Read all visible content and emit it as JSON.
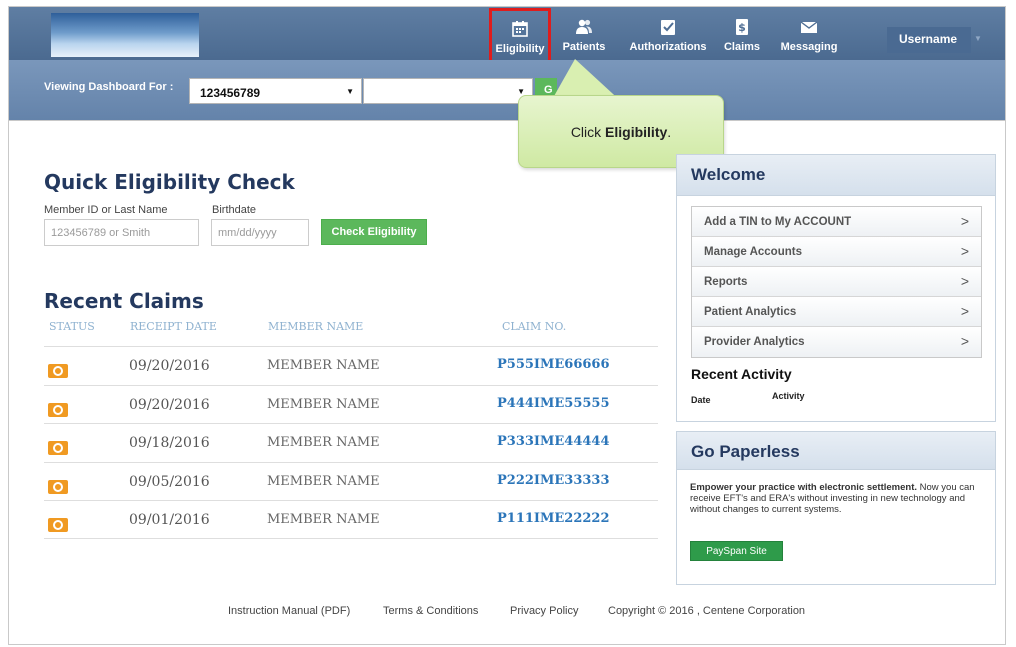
{
  "nav": {
    "items": [
      {
        "label": "Eligibility",
        "icon": "calendar-icon"
      },
      {
        "label": "Patients",
        "icon": "people-icon"
      },
      {
        "label": "Authorizations",
        "icon": "checklist-icon"
      },
      {
        "label": "Claims",
        "icon": "dollar-doc-icon"
      },
      {
        "label": "Messaging",
        "icon": "envelope-icon"
      }
    ],
    "username": "Username"
  },
  "subbar": {
    "viewing_label": "Viewing Dashboard For :",
    "account_value": "123456789",
    "second_value": "",
    "go_label": "G"
  },
  "callout": {
    "prefix": "Click ",
    "emphasis": "Eligibility",
    "suffix": "."
  },
  "quick_eligibility": {
    "title": "Quick Eligibility Check",
    "member_label": "Member ID or Last Name",
    "birth_label": "Birthdate",
    "member_placeholder": "123456789 or Smith",
    "birth_placeholder": "mm/dd/yyyy",
    "button": "Check Eligibility"
  },
  "recent_claims": {
    "title": "Recent Claims",
    "headers": {
      "status": "STATUS",
      "date": "RECEIPT DATE",
      "member": "MEMBER NAME",
      "claim": "CLAIM NO."
    },
    "rows": [
      {
        "date": "09/20/2016",
        "member": "MEMBER NAME",
        "claim": "P555IME66666"
      },
      {
        "date": "09/20/2016",
        "member": "MEMBER NAME",
        "claim": "P444IME55555"
      },
      {
        "date": "09/18/2016",
        "member": "MEMBER NAME",
        "claim": "P333IME44444"
      },
      {
        "date": "09/05/2016",
        "member": "MEMBER NAME",
        "claim": "P222IME33333"
      },
      {
        "date": "09/01/2016",
        "member": "MEMBER NAME",
        "claim": "P111IME22222"
      }
    ]
  },
  "welcome": {
    "title": "Welcome",
    "links": [
      "Add a TIN to My ACCOUNT",
      "Manage Accounts",
      "Reports",
      "Patient Analytics",
      "Provider Analytics"
    ],
    "arrow": ">",
    "recent_activity_title": "Recent Activity",
    "col_date": "Date",
    "col_activity": "Activity"
  },
  "paperless": {
    "title": "Go Paperless",
    "lead": "Empower your practice with electronic settlement.",
    "body": "Now you can receive EFT's and ERA's without investing in new technology and without changes to current systems.",
    "button": "PaySpan Site"
  },
  "footer": {
    "manual": "Instruction Manual (PDF)",
    "terms": "Terms & Conditions",
    "privacy": "Privacy Policy",
    "copyright": "Copyright © 2016 , Centene Corporation"
  },
  "colors": {
    "nav_bg": "#4f6e94",
    "highlight_border": "#e01c1c",
    "green_button": "#5cb85c",
    "claim_link": "#2b75b9",
    "status_orange": "#f09a22",
    "heading_navy": "#24395f"
  }
}
